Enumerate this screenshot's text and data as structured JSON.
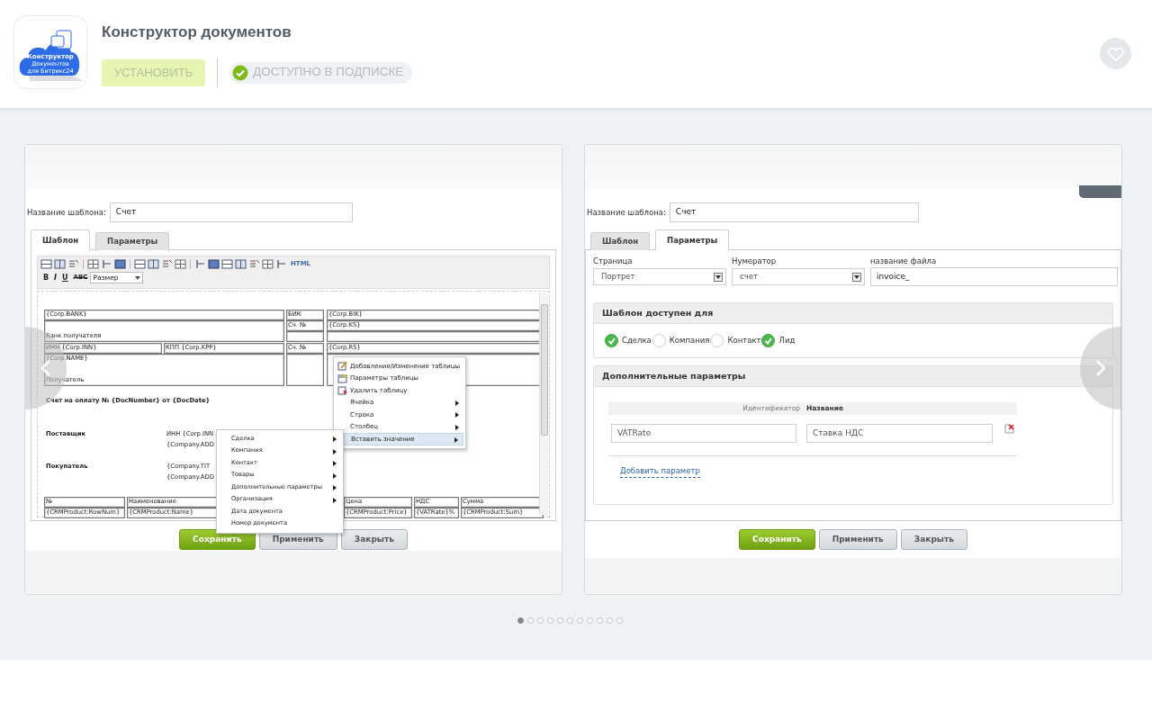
{
  "app": {
    "logo_lines": [
      "Конструктор",
      "Документов",
      "для Битрикс24"
    ],
    "title": "Конструктор документов",
    "install_button": {
      "label": "УСТАНОВИТЬ",
      "disabled": true
    },
    "subscription_badge": "ДОСТУПНО В ПОДПИСКЕ"
  },
  "slides": [
    {
      "kind": "template_editor",
      "template_name_label": "Название шаблона:",
      "template_name_value": "Счет",
      "tabs": [
        {
          "label": "Шаблон",
          "selected": true
        },
        {
          "label": "Параметры",
          "selected": false
        }
      ],
      "format_buttons": [
        "B",
        "I",
        "U",
        "ABC"
      ],
      "size_select": "Размер",
      "html_button": "HTML",
      "document_texts": [
        {
          "text": "{Corp.BANK}",
          "kind": "plain"
        },
        {
          "text": "БИК",
          "kind": "plain"
        },
        {
          "text": "{Corp.BIK}",
          "kind": "plain"
        },
        {
          "text": "Сч. №",
          "kind": "plain"
        },
        {
          "text": "{Corp.KS}",
          "kind": "plain"
        },
        {
          "text": "Банк получателя",
          "kind": "plain"
        },
        {
          "text": "ИНН {Corp.INN}",
          "kind": "plain"
        },
        {
          "text": "КПП {Corp.KPP}",
          "kind": "plain"
        },
        {
          "text": "Сч. №",
          "kind": "plain"
        },
        {
          "text": "{Corp.RS}",
          "kind": "plain"
        },
        {
          "text": "{Corp.NAME}",
          "kind": "plain"
        },
        {
          "text": "Получатель",
          "kind": "plain"
        },
        {
          "text": "Счет на оплату № {DocNumber} от {DocDate}",
          "kind": "bold"
        },
        {
          "text": "Поставщик",
          "kind": "bold"
        },
        {
          "text": "ИНН {Corp.INN",
          "kind": "plain"
        },
        {
          "text": "{Company.ADD",
          "kind": "plain"
        },
        {
          "text": "Покупатель",
          "kind": "bold"
        },
        {
          "text": "{Company.TIT",
          "kind": "plain"
        },
        {
          "text": "{Company.ADD",
          "kind": "plain"
        },
        {
          "text": "№",
          "kind": "plain"
        },
        {
          "text": "Наименование",
          "kind": "plain"
        },
        {
          "text": "Цена",
          "kind": "plain"
        },
        {
          "text": "НДС",
          "kind": "plain"
        },
        {
          "text": "Сумма",
          "kind": "plain"
        },
        {
          "text": "{CRMProduct:RowNum}",
          "kind": "plain"
        },
        {
          "text": "{CRMProduct:Name}",
          "kind": "plain"
        },
        {
          "text": "{CRMProduct:Price}",
          "kind": "plain"
        },
        {
          "text": "{VATRate}%",
          "kind": "plain"
        },
        {
          "text": "{CRMProduct:Sum}",
          "kind": "plain"
        }
      ],
      "table_menu": [
        {
          "label": "Добавление/Изменение таблицы",
          "kind": "action",
          "selected": false
        },
        {
          "label": "Параметры таблицы",
          "kind": "action",
          "selected": false
        },
        {
          "label": "Удалить таблицу",
          "kind": "action",
          "selected": false
        },
        {
          "label": "Ячейка",
          "kind": "submenu",
          "selected": false
        },
        {
          "label": "Строка",
          "kind": "submenu",
          "selected": false
        },
        {
          "label": "Столбец",
          "kind": "submenu",
          "selected": false
        },
        {
          "label": "Вставить значение",
          "kind": "submenu",
          "selected": true
        }
      ],
      "insert_menu": [
        {
          "label": "Сделка",
          "kind": "submenu"
        },
        {
          "label": "Компания",
          "kind": "submenu"
        },
        {
          "label": "Контакт",
          "kind": "submenu"
        },
        {
          "label": "Товары",
          "kind": "submenu"
        },
        {
          "label": "Дополнительные параметры",
          "kind": "submenu"
        },
        {
          "label": "Организация",
          "kind": "submenu"
        },
        {
          "label": "Дата документа",
          "kind": "action"
        },
        {
          "label": "Номер документа",
          "kind": "action"
        }
      ],
      "buttons": [
        "Сохранить",
        "Применить",
        "Закрыть"
      ]
    },
    {
      "kind": "template_params",
      "template_name_label": "Название шаблона:",
      "template_name_value": "Счет",
      "tabs": [
        {
          "label": "Шаблон",
          "selected": false
        },
        {
          "label": "Параметры",
          "selected": true
        }
      ],
      "fields": [
        {
          "label": "Страница",
          "value": "Портрет",
          "kind": "select"
        },
        {
          "label": "Нумератор",
          "value": "счет",
          "kind": "select"
        },
        {
          "label": "название файла",
          "value": "invoice_",
          "kind": "input"
        }
      ],
      "availability": {
        "title": "Шаблон доступен для",
        "options": [
          {
            "label": "Сделка",
            "checked": true
          },
          {
            "label": "Компания",
            "checked": false
          },
          {
            "label": "Контакт",
            "checked": false
          },
          {
            "label": "Лид",
            "checked": true
          }
        ]
      },
      "extra": {
        "title": "Дополнительные параметры",
        "columns": [
          "Идентификатор",
          "Название"
        ],
        "rows": [
          {
            "id": "VATRate",
            "name": "Ставка НДС"
          }
        ],
        "add_link": "Добавить параметр"
      },
      "buttons": [
        "Сохранить",
        "Применить",
        "Закрыть"
      ]
    }
  ],
  "pager": {
    "dots": [
      {
        "selected": true
      },
      {
        "selected": false
      },
      {
        "selected": false
      },
      {
        "selected": false
      },
      {
        "selected": false
      },
      {
        "selected": false
      },
      {
        "selected": false
      },
      {
        "selected": false
      },
      {
        "selected": false
      },
      {
        "selected": false
      },
      {
        "selected": false
      }
    ]
  }
}
